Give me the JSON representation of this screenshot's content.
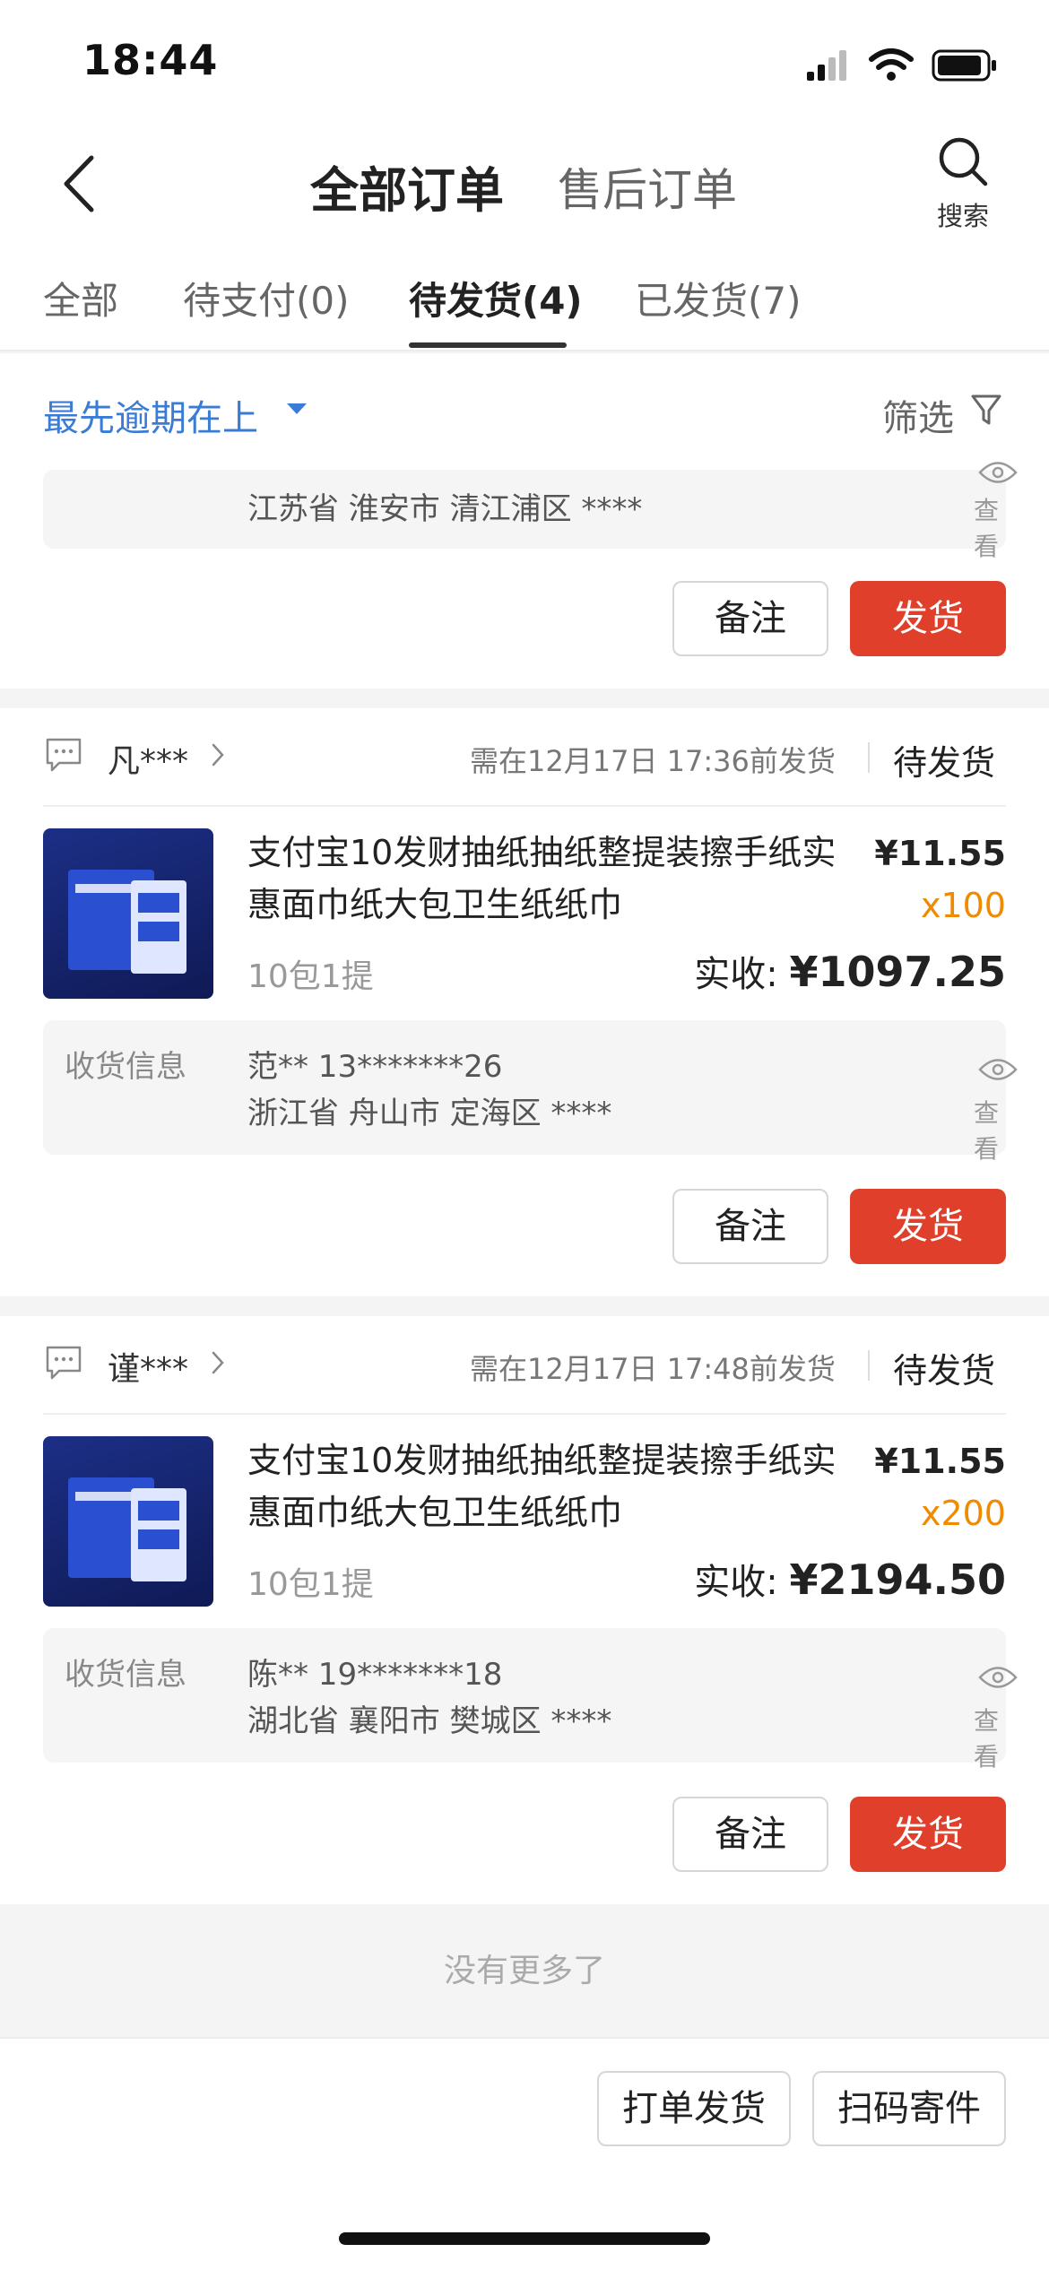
{
  "status_bar": {
    "time": "18:44"
  },
  "nav": {
    "tab_all_orders": "全部订单",
    "tab_after_sales": "售后订单",
    "search_label": "搜索"
  },
  "filter_tabs": [
    {
      "label": "全部"
    },
    {
      "label": "待支付(0)"
    },
    {
      "label": "待发货(4)"
    },
    {
      "label": "已发货(7)"
    }
  ],
  "sort": {
    "label": "最先逾期在上",
    "filter_label": "筛选"
  },
  "partial_order": {
    "address": "江苏省 淮安市 清江浦区 ****",
    "view_label": "查看",
    "note_btn": "备注",
    "ship_btn": "发货"
  },
  "orders": [
    {
      "buyer": "凡***",
      "deadline": "需在12月17日 17:36前发货",
      "status": "待发货",
      "title": "支付宝10发财抽纸抽纸整提装擦手纸实惠面巾纸大包卫生纸纸巾",
      "spec": "10包1提",
      "price": "¥11.55",
      "qty": "x100",
      "paid_label": "实收:",
      "paid_value": "¥1097.25",
      "info_label": "收货信息",
      "contact": "范**   13*******26",
      "address": "浙江省 舟山市 定海区 ****",
      "view_label": "查看",
      "note_btn": "备注",
      "ship_btn": "发货"
    },
    {
      "buyer": "谨***",
      "deadline": "需在12月17日 17:48前发货",
      "status": "待发货",
      "title": "支付宝10发财抽纸抽纸整提装擦手纸实惠面巾纸大包卫生纸纸巾",
      "spec": "10包1提",
      "price": "¥11.55",
      "qty": "x200",
      "paid_label": "实收:",
      "paid_value": "¥2194.50",
      "info_label": "收货信息",
      "contact": "陈**   19*******18",
      "address": "湖北省 襄阳市 樊城区 ****",
      "view_label": "查看",
      "note_btn": "备注",
      "ship_btn": "发货"
    }
  ],
  "footer": {
    "no_more": "没有更多了",
    "print_ship": "打单发货",
    "scan_send": "扫码寄件"
  },
  "colors": {
    "accent_blue": "#3a7bd5",
    "ship_red": "#e0402b",
    "qty_orange": "#f08a00"
  }
}
